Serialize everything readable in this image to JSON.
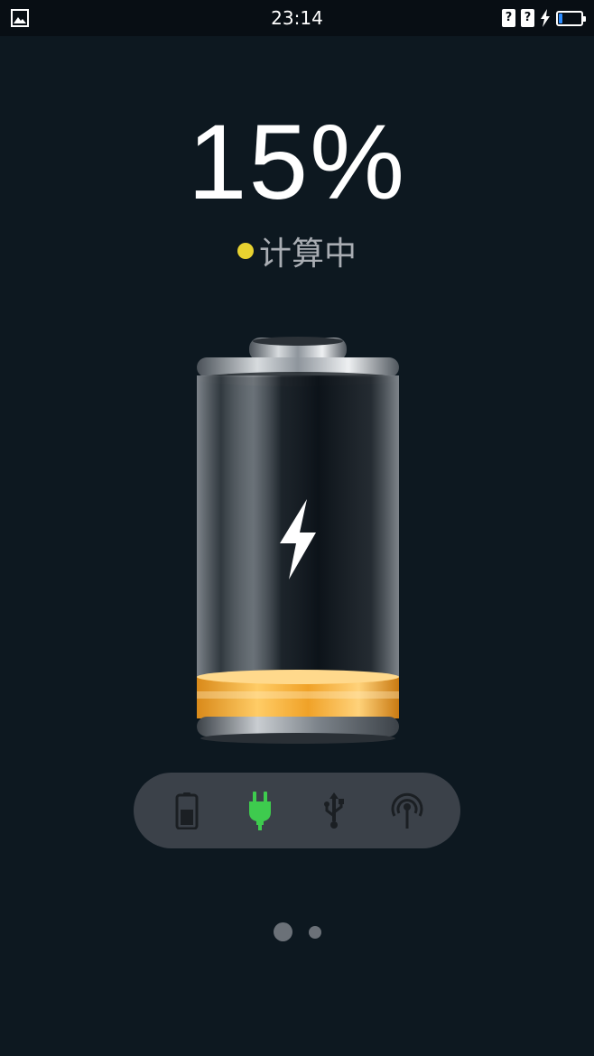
{
  "status_bar": {
    "time": "23:14",
    "left_icon": "gallery-notification-icon",
    "sim1_label": "?",
    "sim2_label": "?",
    "charging_icon": "lightning-icon",
    "battery_icon": "battery-icon"
  },
  "charge": {
    "percent_text": "15%",
    "level": 0.15,
    "status_text": "计算中",
    "status_dot_color": "#e8d230"
  },
  "modes": [
    {
      "name": "battery-mode",
      "icon": "battery-icon",
      "active": false
    },
    {
      "name": "ac-charging-mode",
      "icon": "plug-icon",
      "active": true,
      "color": "#3ecb4e"
    },
    {
      "name": "usb-charging-mode",
      "icon": "usb-icon",
      "active": false
    },
    {
      "name": "wireless-charging-mode",
      "icon": "wireless-icon",
      "active": false
    }
  ],
  "pager": {
    "current_page": 1,
    "page_count": 2
  }
}
